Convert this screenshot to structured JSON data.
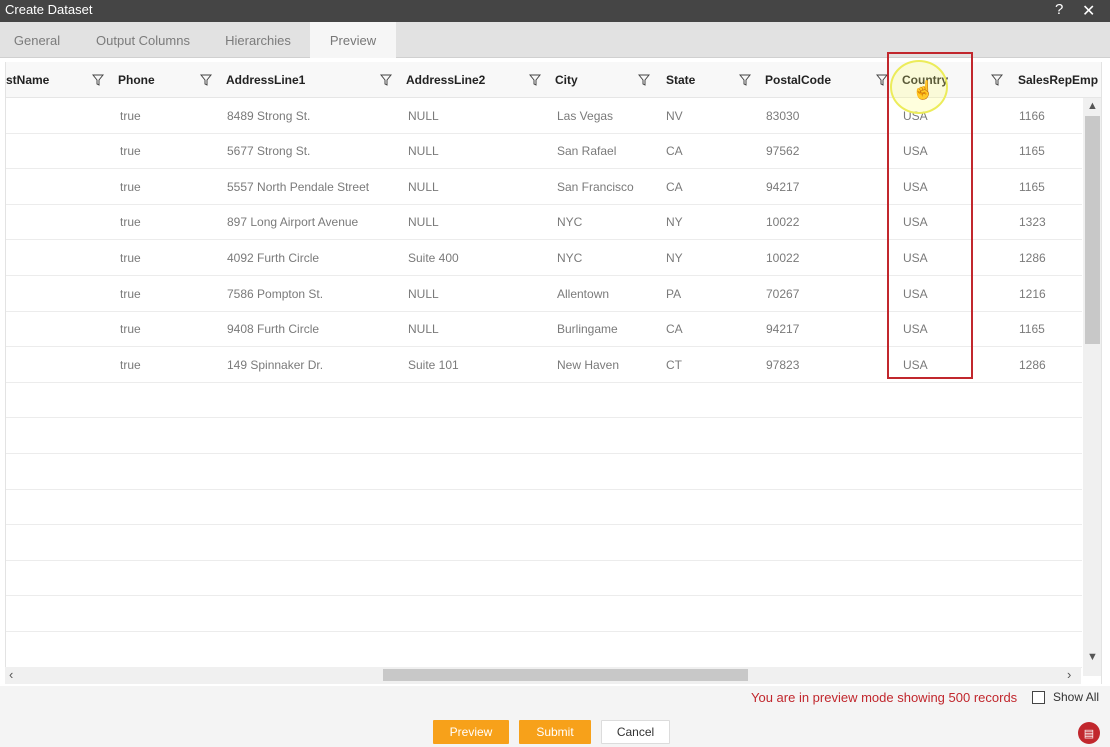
{
  "window": {
    "title": "Create Dataset",
    "help_glyph": "?",
    "close_glyph": "✕"
  },
  "tabs": [
    {
      "label": "General"
    },
    {
      "label": "Output Columns"
    },
    {
      "label": "Hierarchies"
    },
    {
      "label": "Preview"
    }
  ],
  "grid": {
    "columns": [
      "stName",
      "Phone",
      "AddressLine1",
      "AddressLine2",
      "City",
      "State",
      "PostalCode",
      "Country",
      "SalesRepEmp"
    ],
    "rows": [
      [
        "",
        "true",
        "8489 Strong St.",
        "NULL",
        "Las Vegas",
        "NV",
        "83030",
        "USA",
        "1166"
      ],
      [
        "",
        "true",
        "5677 Strong St.",
        "NULL",
        "San Rafael",
        "CA",
        "97562",
        "USA",
        "1165"
      ],
      [
        "",
        "true",
        "5557 North Pendale Street",
        "NULL",
        "San Francisco",
        "CA",
        "94217",
        "USA",
        "1165"
      ],
      [
        "",
        "true",
        "897 Long Airport Avenue",
        "NULL",
        "NYC",
        "NY",
        "10022",
        "USA",
        "1323"
      ],
      [
        "",
        "true",
        "4092 Furth Circle",
        "Suite 400",
        "NYC",
        "NY",
        "10022",
        "USA",
        "1286"
      ],
      [
        "",
        "true",
        "7586 Pompton St.",
        "NULL",
        "Allentown",
        "PA",
        "70267",
        "USA",
        "1216"
      ],
      [
        "",
        "true",
        "9408 Furth Circle",
        "NULL",
        "Burlingame",
        "CA",
        "94217",
        "USA",
        "1165"
      ],
      [
        "",
        "true",
        "149 Spinnaker Dr.",
        "Suite 101",
        "New Haven",
        "CT",
        "97823",
        "USA",
        "1286"
      ]
    ]
  },
  "status": {
    "message": "You are in preview mode showing 500 records",
    "show_all_label": "Show All"
  },
  "buttons": {
    "preview": "Preview",
    "submit": "Submit",
    "cancel": "Cancel"
  },
  "colors": {
    "accent": "#f7a11a",
    "alert": "#c1272d",
    "titlebar": "#454545"
  }
}
